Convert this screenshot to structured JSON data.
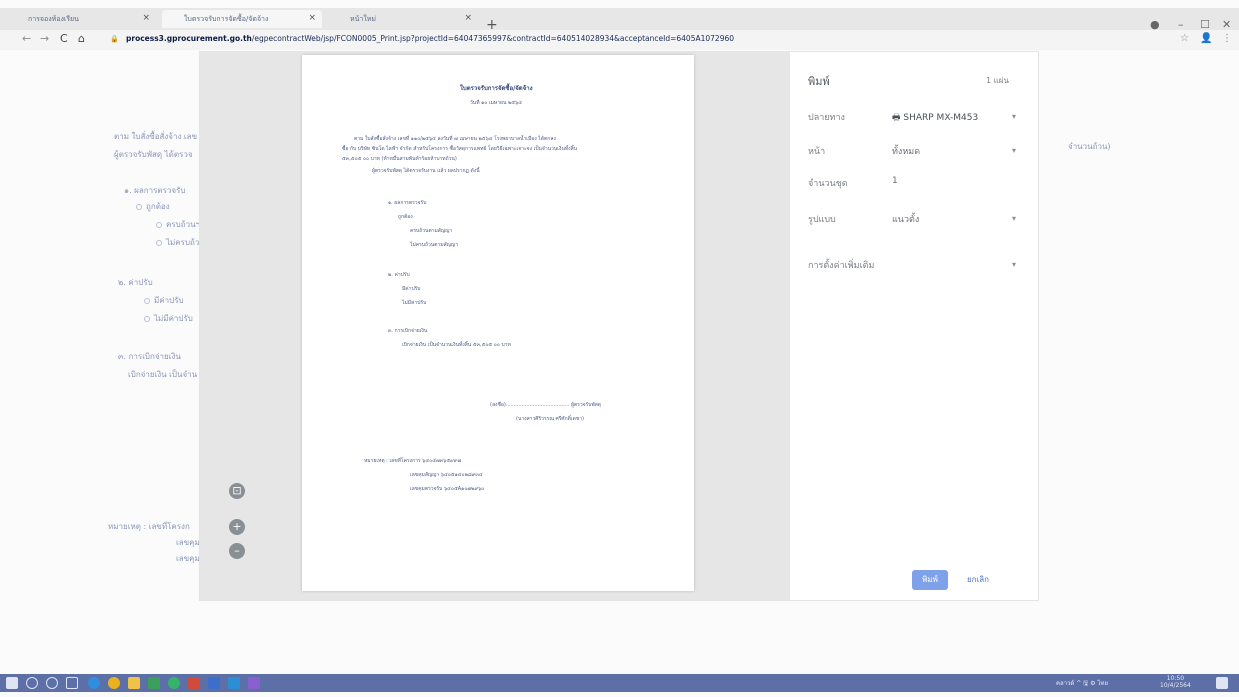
{
  "browser": {
    "tabs": [
      {
        "title": "การจองห้องเรียน"
      },
      {
        "title": "ใบตรวจรับการจัดซื้อ/จัดจ้าง"
      },
      {
        "title": "หน้าใหม่"
      }
    ],
    "new_tab": "+",
    "url_host": "process3.gprocurement.go.th",
    "url_path": "/egpecontractWeb/jsp/FCON0005_Print.jsp?projectId=64047365997&contractId=640514028934&acceptanceId=6405A1072960",
    "controls": {
      "back": "←",
      "forward": "→",
      "reload": "C",
      "home": "⌂",
      "lock": "🔒",
      "minimize": "–",
      "maximize": "☐",
      "close": "✕",
      "star": "☆",
      "profile": "👤",
      "menu": "⋮"
    }
  },
  "background_page": {
    "line1": "ตาม ใบสั่งซื้อสั่งจ้าง เลข",
    "line2": "ผู้ตรวจรับพัสดุ ได้ตรวจ",
    "line_right": "จำนวนถ้วน)",
    "section1": "๑. ผลการตรวจรับ",
    "s1_opt1": "ถูกต้อง",
    "s1_sub1": "ครบถ้วนฯ",
    "s1_sub2": "ไม่ครบถ้วนฯ",
    "section2": "๒. ค่าปรับ",
    "s2_opt1": "มีค่าปรับ",
    "s2_opt2": "ไม่มีค่าปรับ",
    "section3": "๓. การเบิกจ่ายเงิน",
    "s3_text": "เบิกจ่ายเงิน เป็นจำน",
    "note": "หมายเหตุ : เลขที่โครงก",
    "note2": "เลขคุมฯ",
    "note3": "เลขคุมฯ"
  },
  "preview": {
    "title": "ใบตรวจรับการจัดซื้อ/จัดจ้าง",
    "date": "วันที่ ๑๐ เมษายน ๒๕๖๔",
    "p1": "ตาม ใบสั่งซื้อสั่งจ้าง เลขที่ ๑๑๐/๒๕๖๔ ลงวันที่ ๗ เมษายน ๒๕๖๔ โรงพยาบาลน้ำเมือง ได้ตกลง",
    "p2": "ซื้อ กับ บริษัท ซินโด ไลฟ์ฯ จำกัด สำหรับโครงการ ซื้อวัสดุการแพทย์ โดยวิธีเฉพาะเจาะจง เป็นจำนวนเงินทั้งสิ้น",
    "p3": "๕๓,๕๐๕ ๐๐ บาท (ห้าหมื่นสามพันห้าร้อยห้าบาทถ้วน)",
    "p4": "ผู้ตรวจรับพัสดุ ได้ตรวจรับงาน แล้ว ผลปรากฏ ดังนี้",
    "s1": "๑. ผลการตรวจรับ",
    "s1a": "ถูกต้อง",
    "s1b": "ครบถ้วนตามสัญญา",
    "s1c": "ไม่ครบถ้วนตามสัญญา",
    "s2": "๒. ค่าปรับ",
    "s2a": "มีค่าปรับ",
    "s2b": "ไม่มีค่าปรับ",
    "s3": "๓. การเบิกจ่ายเงิน",
    "s3a": "เบิกจ่ายเงิน เป็นจำนวนเงินทั้งสิ้น ๕๓,๕๐๕ ๐๐ บาท",
    "sign1": "(ลงชื่อ)........................................ ผู้ตรวจรับพัสดุ",
    "sign2": "(นางสาวศิริวรรณ ศรีศักดิ์เดชา)",
    "note1": "หมายเหตุ : เลขที่โครงการ ๖๔๐๔๗๓๖๕๙๙๗",
    "note2": "เลขคุมสัญญา ๖๔๐๕๑๔๐๒๘๙๓๔",
    "note3": "เลขคุมตรวจรับ ๖๔๐๕A๑๐๗๒๙๖๐"
  },
  "print_settings": {
    "title": "พิมพ์",
    "sheet_count": "1 แผ่น",
    "destination_label": "ปลายทาง",
    "destination_value": "SHARP MX-M453",
    "pages_label": "หน้า",
    "pages_value": "ทั้งหมด",
    "copies_label": "จำนวนชุด",
    "copies_value": "1",
    "layout_label": "รูปแบบ",
    "layout_value": "แนวตั้ง",
    "more_settings_label": "การตั้งค่าเพิ่มเติม",
    "print_button": "พิมพ์",
    "cancel_button": "ยกเลิก",
    "caret": "▾",
    "printer_icon": "🖶"
  },
  "zoom_controls": {
    "fit": "⊡",
    "zoom_in": "+",
    "zoom_out": "–"
  },
  "taskbar": {
    "tray_text": "คลาวด์ ^ 🖫 ⚙ ไทย",
    "time": "10:50",
    "date": "10/4/2564"
  },
  "colors": {
    "accent_blue": "#7ea1ea",
    "taskbar": "#5d6fa7",
    "link_blue": "#4f72c9"
  }
}
